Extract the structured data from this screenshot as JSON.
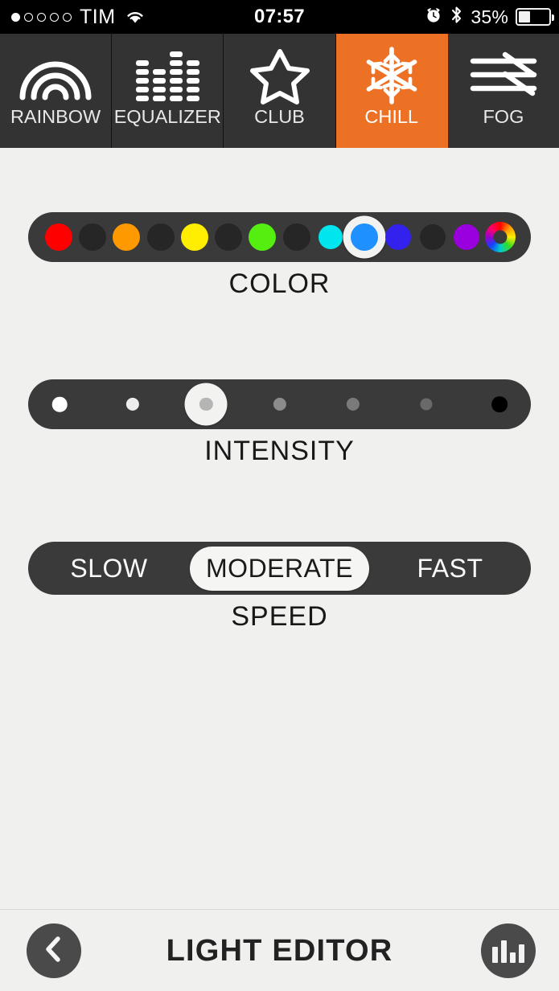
{
  "statusbar": {
    "carrier": "TIM",
    "signal_dots_total": 5,
    "signal_dots_filled": 1,
    "wifi_icon": "wifi-icon",
    "time": "07:57",
    "alarm_icon": "alarm-clock-icon",
    "bluetooth_icon": "bluetooth-icon",
    "battery_percent": "35%",
    "battery_level": 35,
    "background": "#000000"
  },
  "tabs": [
    {
      "label": "RAINBOW",
      "icon": "rainbow-icon",
      "active": false
    },
    {
      "label": "EQUALIZER",
      "icon": "equalizer-icon",
      "active": false
    },
    {
      "label": "CLUB",
      "icon": "star-icon",
      "active": false
    },
    {
      "label": "CHILL",
      "icon": "snowflake-icon",
      "active": true
    },
    {
      "label": "FOG",
      "icon": "fog-icon",
      "active": false
    }
  ],
  "theme": {
    "accent": "#ED7124",
    "tab_background": "#333333",
    "page_background": "#F0F0EF",
    "track_background": "#3A3A3A",
    "knob": "#F2F2F0",
    "text_dark": "#181818"
  },
  "controls": {
    "color": {
      "label": "COLOR",
      "selected_index": 9,
      "selected_color": "#1E90FF",
      "swatches": [
        {
          "name": "red",
          "color": "#FF0000",
          "size": 17
        },
        {
          "name": "off-1",
          "color": "#262626",
          "size": 17
        },
        {
          "name": "orange",
          "color": "#FF9900",
          "size": 17
        },
        {
          "name": "off-2",
          "color": "#262626",
          "size": 17
        },
        {
          "name": "yellow",
          "color": "#FFEE00",
          "size": 17
        },
        {
          "name": "off-3",
          "color": "#262626",
          "size": 17
        },
        {
          "name": "green",
          "color": "#55EE11",
          "size": 17
        },
        {
          "name": "off-4",
          "color": "#262626",
          "size": 17
        },
        {
          "name": "cyan",
          "color": "#00E5EE",
          "size": 15
        },
        {
          "name": "blue",
          "color": "#1E90FF",
          "size": 17
        },
        {
          "name": "blue-violet",
          "color": "#3322EE",
          "size": 16
        },
        {
          "name": "off-5",
          "color": "#262626",
          "size": 16
        },
        {
          "name": "purple",
          "color": "#9900DD",
          "size": 16
        },
        {
          "name": "rainbow",
          "color": "rainbow",
          "size": 19
        }
      ]
    },
    "intensity": {
      "label": "INTENSITY",
      "selected_index": 2,
      "steps": [
        {
          "name": "level-1",
          "color": "#FFFFFF",
          "size": 16
        },
        {
          "name": "level-2",
          "color": "#EDEDED",
          "size": 14
        },
        {
          "name": "level-3",
          "color": "#B5B5B5",
          "size": 14
        },
        {
          "name": "level-4",
          "color": "#8C8C8C",
          "size": 14
        },
        {
          "name": "level-5",
          "color": "#7A7A7A",
          "size": 14
        },
        {
          "name": "level-6",
          "color": "#6A6A6A",
          "size": 13
        },
        {
          "name": "level-7",
          "color": "#000000",
          "size": 17
        }
      ]
    },
    "speed": {
      "label": "SPEED",
      "selected": "MODERATE",
      "options": [
        "SLOW",
        "MODERATE",
        "FAST"
      ]
    }
  },
  "bottombar": {
    "title": "LIGHT EDITOR",
    "back_icon": "chevron-left-icon",
    "chart_icon": "bar-chart-icon"
  }
}
